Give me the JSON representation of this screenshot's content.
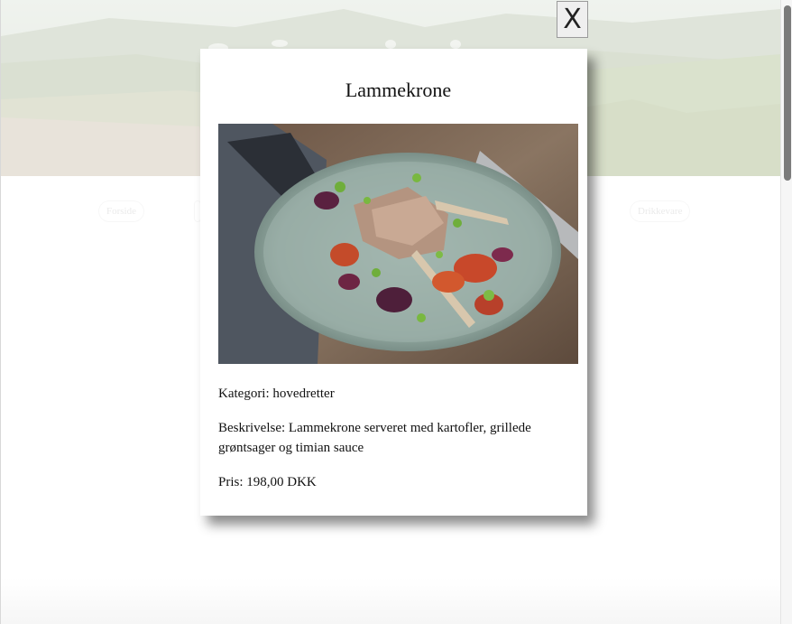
{
  "background": {
    "nav": {
      "left_label": "Forside",
      "right_label": "Drikkevare"
    }
  },
  "modal": {
    "close_label": "X",
    "title": "Lammekrone",
    "category_label": "Kategori:",
    "category_value": "hovedretter",
    "description_label": "Beskrivelse:",
    "description_value": "Lammekrone serveret med kartofler, grillede grøntsager og timian sauce",
    "price_label": "Pris:",
    "price_value": "198,00 DKK"
  },
  "icons": {
    "close": "close-icon"
  },
  "colors": {
    "modal_background": "#ffffff",
    "text": "#111111",
    "close_button_background": "#efefef"
  }
}
